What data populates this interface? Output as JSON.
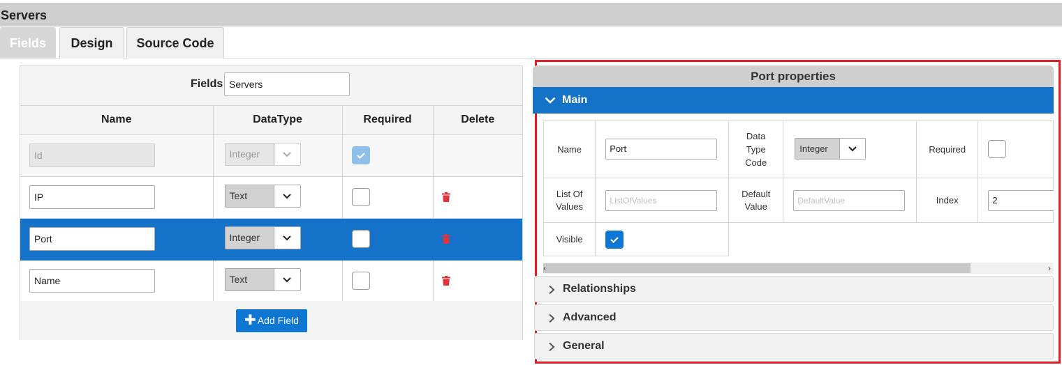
{
  "window": {
    "title": "Servers"
  },
  "tabs": [
    {
      "label": "Fields",
      "active": true
    },
    {
      "label": "Design",
      "active": false
    },
    {
      "label": "Source Code",
      "active": false
    }
  ],
  "fields_panel": {
    "label": "Fields",
    "name_value": "Servers",
    "columns": [
      "Name",
      "DataType",
      "Required",
      "Delete"
    ],
    "rows": [
      {
        "name": "Id",
        "datatype": "Integer",
        "required": true,
        "disabled": true,
        "deletable": false,
        "selected": false
      },
      {
        "name": "IP",
        "datatype": "Text",
        "required": false,
        "disabled": false,
        "deletable": true,
        "selected": false
      },
      {
        "name": "Port",
        "datatype": "Integer",
        "required": false,
        "disabled": false,
        "deletable": true,
        "selected": true
      },
      {
        "name": "Name",
        "datatype": "Text",
        "required": false,
        "disabled": false,
        "deletable": true,
        "selected": false
      }
    ],
    "add_button": "Add Field"
  },
  "properties": {
    "title": "Port properties",
    "main": {
      "label": "Main",
      "name_label": "Name",
      "name_value": "Port",
      "datatype_label_1": "Data",
      "datatype_label_2": "Type",
      "datatype_label_3": "Code",
      "datatype_value": "Integer",
      "required_label": "Required",
      "required_checked": false,
      "lov_label_1": "List Of",
      "lov_label_2": "Values",
      "lov_placeholder": "ListOfValues",
      "default_label_1": "Default",
      "default_label_2": "Value",
      "default_placeholder": "DefaultValue",
      "index_label": "Index",
      "index_value": "2",
      "visible_label": "Visible",
      "visible_checked": true
    },
    "sections": [
      "Relationships",
      "Advanced",
      "General"
    ]
  },
  "colors": {
    "accent": "#1473c9",
    "highlight_border": "#e21d25",
    "delete_icon": "#e0343d"
  }
}
